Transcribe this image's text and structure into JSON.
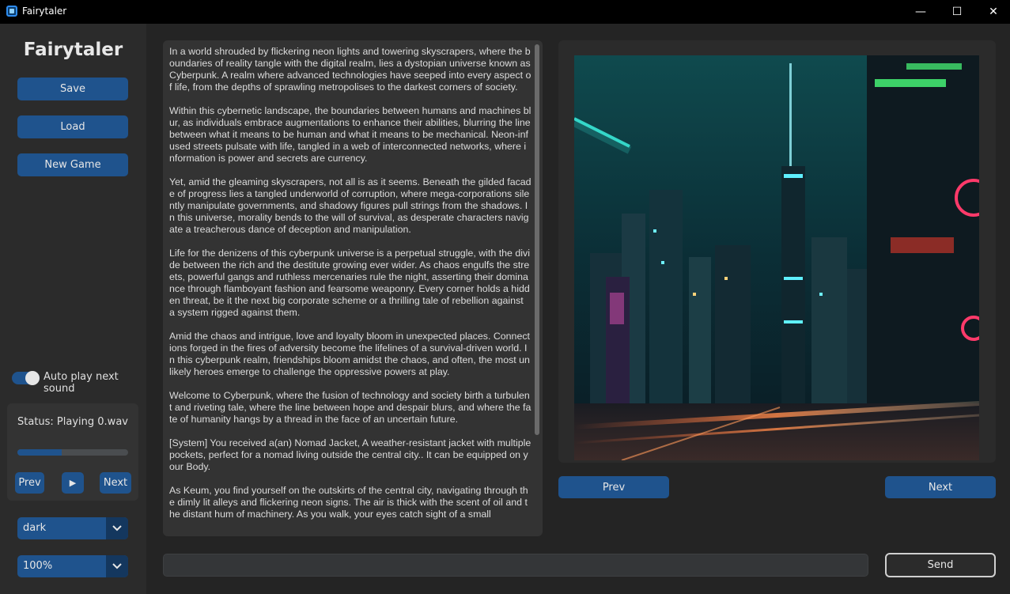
{
  "window": {
    "title": "Fairytaler",
    "minimize": "—",
    "maximize": "☐",
    "close": "✕"
  },
  "sidebar": {
    "brand": "Fairytaler",
    "save_label": "Save",
    "load_label": "Load",
    "new_game_label": "New Game",
    "autoplay_label": "Auto play next sound",
    "autoplay_on": true,
    "status_text": "Status: Playing 0.wav",
    "progress_fraction": 0.4,
    "prev_label": "Prev",
    "play_icon": "▶",
    "next_label": "Next",
    "theme_value": "dark",
    "zoom_value": "100%"
  },
  "story": {
    "paragraphs": [
      "In a world shrouded by flickering neon lights and towering skyscrapers, where the boundaries of reality tangle with the digital realm, lies a dystopian universe known as Cyberpunk. A realm where advanced technologies have seeped into every aspect of life, from the depths of sprawling metropolises to the darkest corners of society.",
      "Within this cybernetic landscape, the boundaries between humans and machines blur, as individuals embrace augmentations to enhance their abilities, blurring the line between what it means to be human and what it means to be mechanical. Neon-infused streets pulsate with life, tangled in a web of interconnected networks, where information is power and secrets are currency.",
      "Yet, amid the gleaming skyscrapers, not all is as it seems. Beneath the gilded facade of progress lies a tangled underworld of corruption, where mega-corporations silently manipulate governments, and shadowy figures pull strings from the shadows. In this universe, morality bends to the will of survival, as desperate characters navigate a treacherous dance of deception and manipulation.",
      "Life for the denizens of this cyberpunk universe is a perpetual struggle, with the divide between the rich and the destitute growing ever wider. As chaos engulfs the streets, powerful gangs and ruthless mercenaries rule the night, asserting their dominance through flamboyant fashion and fearsome weaponry. Every corner holds a hidden threat, be it the next big corporate scheme or a thrilling tale of rebellion against a system rigged against them.",
      "Amid the chaos and intrigue, love and loyalty bloom in unexpected places. Connections forged in the fires of adversity become the lifelines of a survival-driven world. In this cyberpunk realm, friendships bloom amidst the chaos, and often, the most unlikely heroes emerge to challenge the oppressive powers at play.",
      "Welcome to Cyberpunk, where the fusion of technology and society birth a turbulent and riveting tale, where the line between hope and despair blurs, and where the fate of humanity hangs by a thread in the face of an uncertain future.",
      "[System] You received a(an) Nomad Jacket, A weather-resistant jacket with multiple pockets, perfect for a nomad living outside the central city.. It can be equipped on your Body.",
      "As Keum, you find yourself on the outskirts of the central city, navigating through the dimly lit alleys and flickering neon signs. The air is thick with the scent of oil and the distant hum of machinery. As you walk, your eyes catch sight of a small"
    ]
  },
  "image_nav": {
    "prev_label": "Prev",
    "next_label": "Next"
  },
  "input": {
    "value": "",
    "send_label": "Send"
  },
  "colors": {
    "accent": "#1f538d",
    "background": "#242424",
    "panel": "#2b2b2b",
    "neon_cyan": "#39e6d6",
    "neon_pink": "#ff3a6a"
  }
}
